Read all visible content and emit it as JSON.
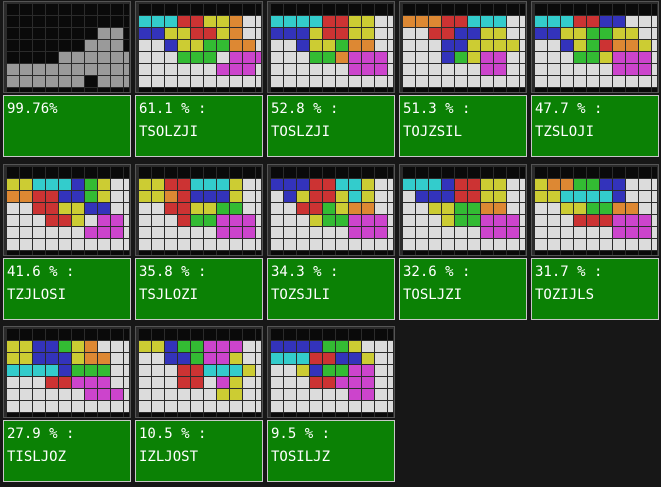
{
  "colors": {
    "background": "#171717",
    "label_bg": "#0b8105",
    "label_text": "#ffffff",
    "empty_cell": "#dcdcdc",
    "top_empty_cell": "#0a0a0a",
    "gray_block": "#9a9a9a",
    "black_cell": "#0a0a0a",
    "piece_colors": {
      "T": "#cc44cc",
      "S": "#33bb33",
      "O": "#cccc33",
      "L": "#dd8833",
      "Z": "#cc3333",
      "J": "#3333bb",
      "I": "#33cccc"
    }
  },
  "results": [
    {
      "percent": "99.76%",
      "order": ""
    },
    {
      "percent": "61.1 % :",
      "order": "TSOLZJI"
    },
    {
      "percent": "52.8 % :",
      "order": "TOSLZJI"
    },
    {
      "percent": "51.3 % :",
      "order": "TOJZSIL"
    },
    {
      "percent": "47.7 % :",
      "order": "TZSLOJI"
    },
    {
      "percent": "41.6 % :",
      "order": "TZJLOSI"
    },
    {
      "percent": "35.8 % :",
      "order": "TSJLOZI"
    },
    {
      "percent": "34.3 % :",
      "order": "TOZSJLI"
    },
    {
      "percent": "32.6 % :",
      "order": "TOSLJZI"
    },
    {
      "percent": "31.7 % :",
      "order": "TOZIJLS"
    },
    {
      "percent": "27.9 % :",
      "order": "TISLJOZ"
    },
    {
      "percent": "10.5 % :",
      "order": "IZLJOST"
    },
    {
      "percent": "9.5 % :",
      "order": "TOSILJZ"
    }
  ],
  "boards": [
    [
      "..........",
      ".........#",
      ".......gg#",
      "#.#...ggg#",
      "....gggggg",
      "gggggggggg",
      "gggggg.ggg"
    ],
    [
      "..........",
      "IIIZZOOL..",
      "JJOOZZOL..",
      "..JOOSSLL.",
      "...SSS.TTT",
      "......TTT.",
      "..........",
      ".........."
    ],
    [
      "..........",
      "IIIIZZOO..",
      "JJJOZZOO..",
      "..JOOSLL..",
      "...SSLTTT.",
      "......TTT.",
      ".........."
    ],
    [
      "..........",
      "LLLZZIII..",
      "..ZZJJOO..",
      "...JJOOOO.",
      "...JSOTT..",
      "......TT..",
      ".........."
    ],
    [
      "..........",
      "IIIZZJJ...",
      "JJOOSSOO..",
      "..JOSZLLO.",
      "...SSOTTT.",
      "......TTT.",
      ".........."
    ],
    [
      "..........",
      "OOIIIJSO..",
      "LLZZJJSO..",
      "..ZZOOJJ..",
      "...ZZO.TT.",
      "......TTT.",
      ".........."
    ],
    [
      "..........",
      "OOZZIIIO..",
      "OOLZJJJO..",
      "..ZZOOSS..",
      "...ZSSTTT.",
      "......TTT.",
      ".........."
    ],
    [
      "..........",
      "JJJZZIIO..",
      ".JOZZOIO..",
      "..ZZSOLL..",
      "...OSSTTT.",
      "......TTT.",
      ".........."
    ],
    [
      "..........",
      "IIIJZZOO..",
      ".JJJZZOO..",
      "..OOSSLL..",
      "...OSSTTT.",
      "......TTT.",
      ".........."
    ],
    [
      "..........",
      "OLLSSJJ...",
      "OOIIIIJ...",
      "..OOSSLL..",
      "...ZZZTTT.",
      "......TTT.",
      ".........."
    ],
    [
      "..........",
      "OOJJSOL...",
      "OOJJJOLL..",
      "IIIIJSSS..",
      "...ZZTTT..",
      "......TTT.",
      ".........."
    ],
    [
      "..........",
      "OOJSSTTT..",
      "..JJSTTO..",
      "...ZZIIIO.",
      "...ZZ.TO..",
      "......OO..",
      ".........."
    ],
    [
      "..........",
      "JJJJSSO...",
      "IIIZZJJO..",
      "..OJSSTT..",
      "...ZZTTT..",
      "......TT..",
      ".........."
    ]
  ]
}
